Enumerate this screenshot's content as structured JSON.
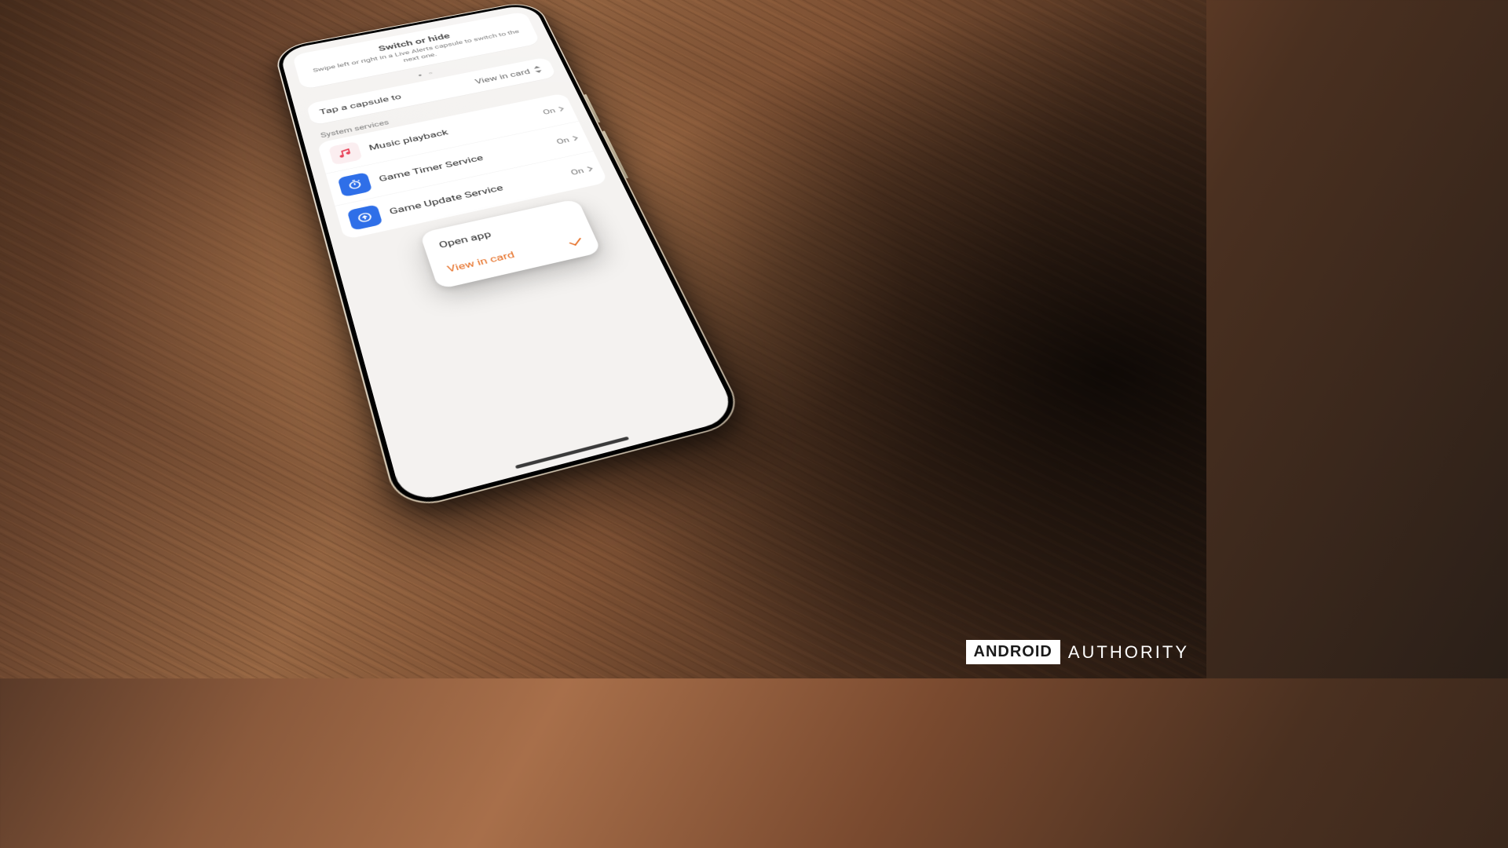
{
  "hint": {
    "title": "Switch or hide",
    "subtitle": "Swipe left or right in a Live Alerts capsule to switch to the next one."
  },
  "tap_capsule": {
    "label": "Tap a capsule to",
    "value": "View in card"
  },
  "section_label": "System services",
  "popup": {
    "options": [
      {
        "label": "Open app",
        "selected": false
      },
      {
        "label": "View in card",
        "selected": true
      }
    ]
  },
  "services": [
    {
      "name": "Music playback",
      "state": "On",
      "icon": "music"
    },
    {
      "name": "Game Timer Service",
      "state": "On",
      "icon": "stopwatch"
    },
    {
      "name": "Game Update Service",
      "state": "On",
      "icon": "upload"
    }
  ],
  "watermark": {
    "brand_boxed": "ANDROID",
    "brand_light": "AUTHORITY"
  }
}
